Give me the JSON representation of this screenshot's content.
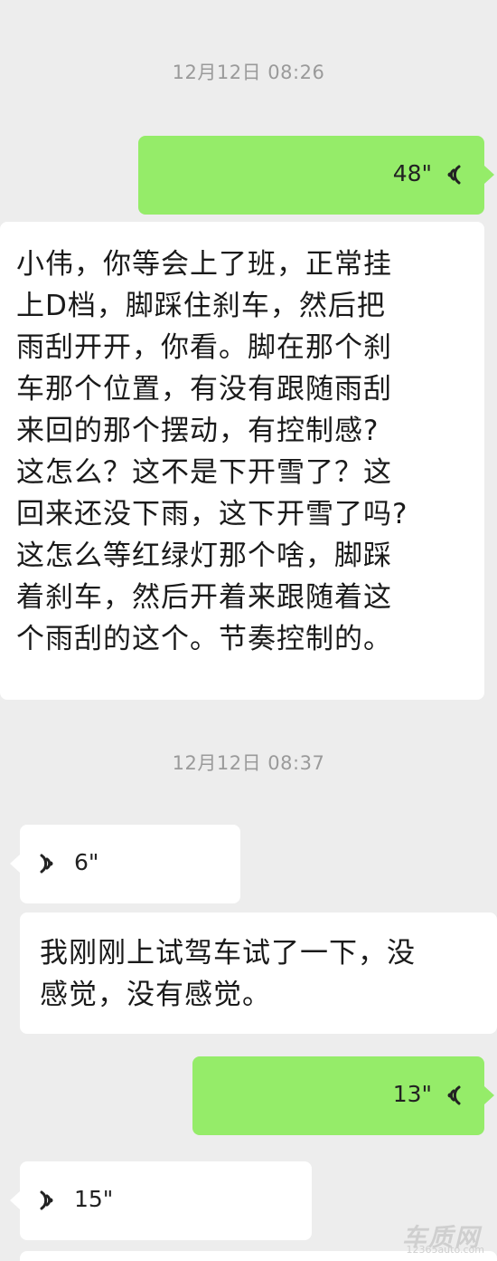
{
  "timestamps": [
    "12月12日 08:26",
    "12月12日 08:37"
  ],
  "messages": {
    "voice1": {
      "duration": "48\""
    },
    "text1": "小伟，你等会上了班，正常挂\n上D档，脚踩住刹车，然后把\n雨刮开开，你看。脚在那个刹\n车那个位置，有没有跟随雨刮\n来回的那个摆动，有控制感?\n这怎么？这不是下开雪了？这\n回来还没下雨，这下开雪了吗?\n这怎么等红绿灯那个啥，脚踩\n着刹车，然后开着来跟随着这\n个雨刮的这个。节奏控制的。",
    "voice2": {
      "duration": "6\""
    },
    "text2": "我刚刚上试驾车试了一下，没\n感觉，没有感觉。",
    "voice3": {
      "duration": "13\""
    },
    "voice4": {
      "duration": "15\""
    }
  },
  "watermark": {
    "logo": "车质网",
    "url": "12365auto.com"
  },
  "colors": {
    "sent_bubble": "#95ec69",
    "received_bubble": "#ffffff",
    "background": "#ededed"
  }
}
